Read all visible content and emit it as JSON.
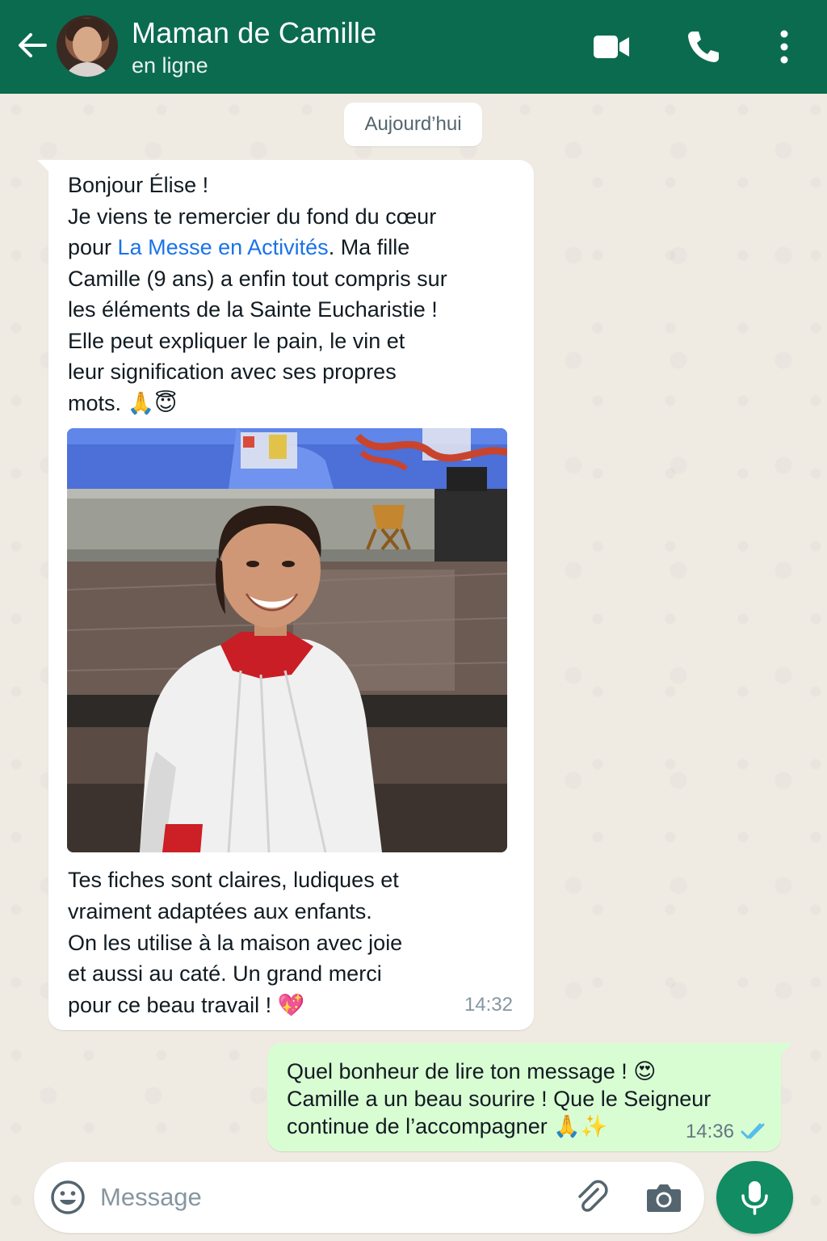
{
  "header": {
    "contact_name": "Maman de Camille",
    "status": "en ligne",
    "bg_color": "#0b6b4f",
    "icons": [
      "back-arrow-icon",
      "video-call-icon",
      "phone-icon",
      "more-vert-icon"
    ]
  },
  "date_chip": "Aujourd’hui",
  "incoming": {
    "intro_before_link": "Bonjour Élise !\nJe viens te remercier du fond du cœur\npour ",
    "link_text": "La Messe en Activités",
    "intro_after_link": ". Ma fille\nCamille (9 ans) a enfin tout compris sur\nles éléments de la Sainte Eucharistie !\nElle peut expliquer le pain, le vin et\nleur signification avec ses propres\nmots. 🙏😇",
    "closing": "Tes fiches sont claires, ludiques et\nvraiment adaptées aux enfants.\nOn les utilise à la maison avec joie\net aussi au caté. Un grand merci\npour ce beau travail ! 💖",
    "time": "14:32"
  },
  "outgoing": {
    "text": "Quel bonheur de lire ton message ! 😍\nCamille a un beau sourire ! Que le Seigneur\ncontinue de l’accompagner 🙏✨",
    "time": "14:36",
    "status": "read"
  },
  "composer": {
    "placeholder": "Message",
    "value": "",
    "icons": [
      "emoji-icon",
      "attach-icon",
      "camera-icon",
      "mic-icon"
    ]
  },
  "colors": {
    "accent": "#128c62",
    "link": "#1a73e8",
    "bubble_out": "#d9fdd3",
    "read_ticks": "#53bdeb"
  }
}
